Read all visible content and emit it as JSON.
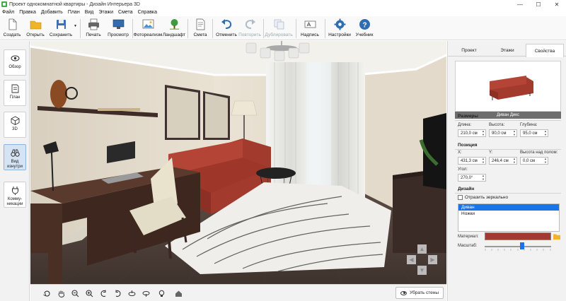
{
  "window": {
    "title": "Проект однокомнатной квартиры - Дизайн Интерьера 3D",
    "minimize": "—",
    "maximize": "☐",
    "close": "✕"
  },
  "menu": [
    "Файл",
    "Правка",
    "Добавить",
    "План",
    "Вид",
    "Этажи",
    "Смета",
    "Справка"
  ],
  "toolbar": {
    "create": "Создать",
    "open": "Открыть",
    "save": "Сохранить",
    "print": "Печать",
    "preview": "Просмотр",
    "photorealism": "Фотореализм",
    "landscape": "Ландшафт",
    "estimate": "Смета",
    "undo": "Отменить",
    "redo": "Повторить",
    "duplicate": "Дублировать",
    "label": "Надпись",
    "settings": "Настройки",
    "tutorial": "Учебник"
  },
  "sidebar": {
    "items": [
      {
        "label": "Обзор",
        "icon": "eye-icon"
      },
      {
        "label": "План",
        "icon": "plan-icon"
      },
      {
        "label": "3D",
        "icon": "cube-icon"
      },
      {
        "label": "Вид изнутри",
        "icon": "binoculars-icon"
      },
      {
        "label": "Комму-никации",
        "icon": "plug-icon"
      }
    ]
  },
  "viewbar": {
    "remove_walls": "Убрать стены"
  },
  "panel": {
    "tabs": [
      "Проект",
      "Этажи",
      "Свойства"
    ],
    "active_tab": "Свойства",
    "object_name": "Диван Дикс",
    "sizes": {
      "title": "Размеры",
      "length_label": "Длина:",
      "length_value": "210,0 см",
      "height_label": "Высота:",
      "height_value": "90,0 см",
      "depth_label": "Глубина:",
      "depth_value": "95,0 см"
    },
    "position": {
      "title": "Позиция",
      "x_label": "X:",
      "x_value": "431,3 см",
      "y_label": "Y:",
      "y_value": "246,4 см",
      "floor_label": "Высота над полом:",
      "floor_value": "0,0 см",
      "angle_label": "Угол:",
      "angle_value": "270,0°"
    },
    "design": {
      "title": "Дизайн",
      "mirror_label": "Отразить зеркально",
      "parts": [
        "Диван",
        "Ножки"
      ],
      "selected_part": "Диван",
      "material_label": "Материал:",
      "material_color": "#a33a2e",
      "scale_label": "Масштаб:",
      "scale_fraction": 0.56
    }
  }
}
